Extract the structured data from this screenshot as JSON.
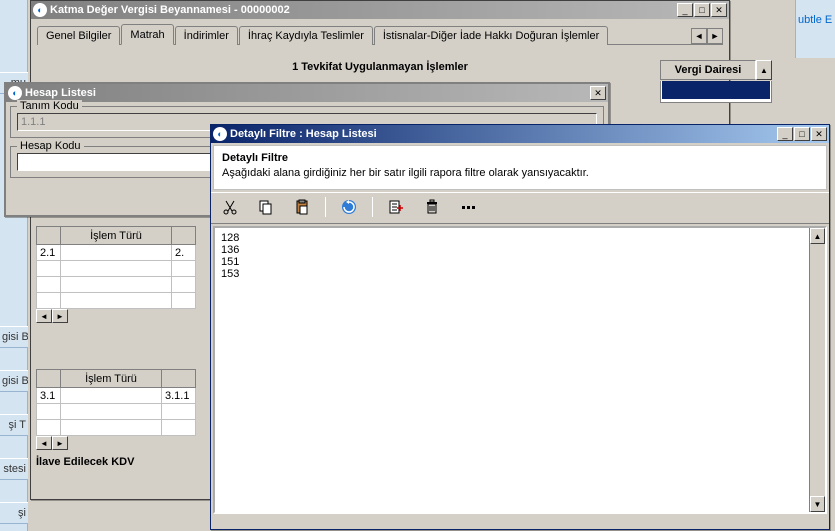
{
  "app": {
    "right_hint": "ubtle E"
  },
  "left_sidebar": {
    "items": [
      "mu",
      "gisi Be",
      "gisi Be",
      "şi T",
      "stesi",
      "şi"
    ]
  },
  "win1": {
    "title": "Katma Değer Vergisi Beyannamesi - 00000002",
    "tabs": [
      "Genel Bilgiler",
      "Matrah",
      "İndirimler",
      "İhraç Kaydıyla Teslimler",
      "İstisnalar-Diğer İade Hakkı Doğuran İşlemler"
    ],
    "active_tab_index": 1,
    "section_title": "1 Tevkifat Uygulanmayan İşlemler",
    "tables": {
      "t1": {
        "header": "İşlem Türü",
        "cells": [
          [
            "2.1",
            "",
            "2."
          ],
          [
            "",
            "",
            ""
          ],
          [
            "",
            "",
            ""
          ]
        ]
      },
      "t2": {
        "header": "İşlem Türü",
        "cells": [
          [
            "3.1",
            "",
            "3.1.1"
          ],
          [
            "",
            "",
            ""
          ]
        ]
      }
    },
    "extra_label": "İlave Edilecek KDV",
    "vergi_header": "Vergi Dairesi"
  },
  "win2": {
    "title": "Hesap Listesi",
    "tanim_kodu_label": "Tanım Kodu",
    "tanim_kodu_value": "1.1.1",
    "hesap_kodu_label": "Hesap Kodu",
    "hesap_kodu_value": ""
  },
  "win3": {
    "title": "Detaylı Filtre : Hesap Listesi",
    "info_title": "Detaylı Filtre",
    "info_text": "Aşağıdaki alana girdiğiniz her bir satır ilgili rapora filtre olarak yansıyacaktır.",
    "toolbar": [
      "cut",
      "copy",
      "paste",
      "sep",
      "refresh",
      "sep",
      "insert-row",
      "delete",
      "more"
    ],
    "filter_text": "128\n136\n151\n153"
  }
}
